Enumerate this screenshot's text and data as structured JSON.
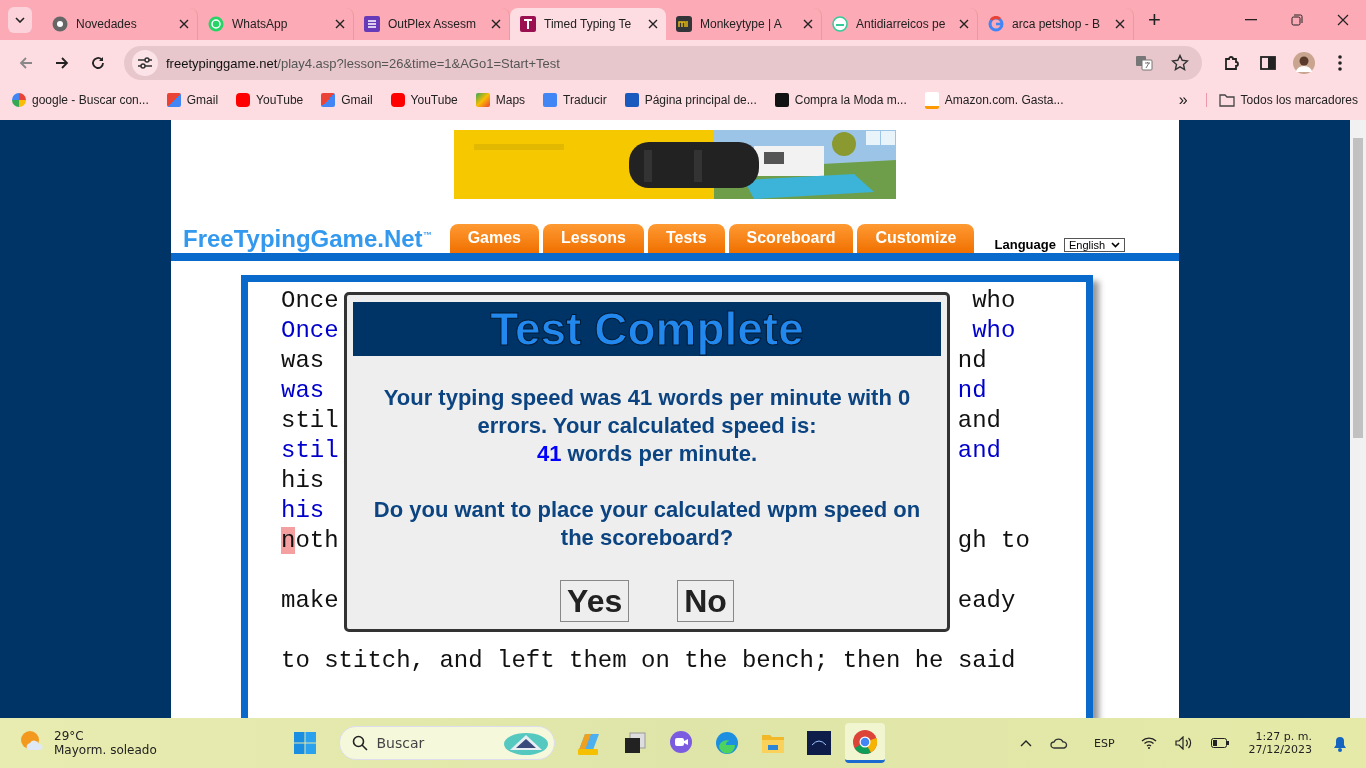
{
  "browser": {
    "tabs": [
      {
        "title": "Novedades",
        "selected": false
      },
      {
        "title": "WhatsApp",
        "selected": false
      },
      {
        "title": "OutPlex Assesm",
        "selected": false
      },
      {
        "title": "Timed Typing Te",
        "selected": true
      },
      {
        "title": "Monkeytype | A",
        "selected": false
      },
      {
        "title": "Antidiarreicos pe",
        "selected": false
      },
      {
        "title": "arca petshop - B",
        "selected": false
      }
    ],
    "new_tab": "+",
    "address": {
      "host": "freetypinggame.net",
      "path": "/play4.asp?lesson=26&time=1&AGo1=Start+Test"
    },
    "bookmarks": [
      "google - Buscar con...",
      "Gmail",
      "YouTube",
      "Gmail",
      "YouTube",
      "Maps",
      "Traducir",
      "Página principal de...",
      "Compra la Moda m...",
      "Amazon.com. Gasta..."
    ],
    "more_bookmarks": "»",
    "all_bookmarks": "Todos los marcadores"
  },
  "site": {
    "logo": "FreeTypingGame.Net",
    "logo_mark": "™",
    "nav": [
      "Games",
      "Lessons",
      "Tests",
      "Scoreboard",
      "Customize"
    ],
    "language_label": "Language",
    "language": "English"
  },
  "typing_lines": [
    {
      "kind": "original",
      "left": "Once",
      "right": "who"
    },
    {
      "kind": "typed",
      "left": "Once",
      "right": "who"
    },
    {
      "kind": "original",
      "left": "was",
      "right": "nd"
    },
    {
      "kind": "typed",
      "left": "was",
      "right": "nd"
    },
    {
      "kind": "original",
      "left": "stil",
      "right": "and"
    },
    {
      "kind": "typed",
      "left": "stil",
      "right": "and"
    },
    {
      "kind": "original",
      "left": "his"
    },
    {
      "kind": "typed",
      "left": "his"
    },
    {
      "kind": "original",
      "left": "noth",
      "right": "gh to",
      "cursor_first": true
    },
    {
      "kind": "blank"
    },
    {
      "kind": "original",
      "left": "make",
      "right": "eady"
    },
    {
      "kind": "blank"
    },
    {
      "kind": "original",
      "left": "to stitch, and left them on the bench; then he said"
    }
  ],
  "dialog": {
    "title": "Test Complete",
    "result": "Your typing speed was 41 words per minute with 0 errors. Your calculated speed is:",
    "speed": "41",
    "speed_unit": "words per minute.",
    "question": "Do you want to place your calculated wpm speed on the scoreboard?",
    "buttons": [
      "Yes",
      "No"
    ]
  },
  "taskbar": {
    "temperature": "29°C",
    "weather": "Mayorm. soleado",
    "search_placeholder": "Buscar",
    "apps": [
      {
        "selected": false
      },
      {
        "selected": false
      },
      {
        "selected": false
      },
      {
        "selected": false
      },
      {
        "selected": false
      },
      {
        "selected": false
      },
      {
        "selected": true
      }
    ],
    "language": "ESP",
    "time": "1:27 p. m.",
    "date": "27/12/2023"
  }
}
